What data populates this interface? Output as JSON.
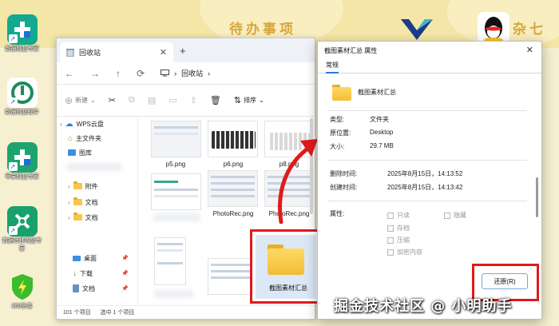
{
  "wallpaper": {
    "banner_text": "待办事项",
    "banner_text_right": "杂七杂",
    "colors": {
      "band": "#f3e6a6",
      "accent": "#d9a63c"
    }
  },
  "desktop": {
    "icons": [
      {
        "label": "数据恢复专家",
        "icon": "data-recovery-icon",
        "color": "#13a88f"
      },
      {
        "label": "数据恢复软件",
        "icon": "recovery-software-icon",
        "color": "#1e8a5a"
      },
      {
        "label": "苹果恢复专家",
        "icon": "apple-recovery-icon",
        "color": "#1ea36e"
      },
      {
        "label": "数据迁移恢复专家",
        "icon": "migration-recovery-icon",
        "color": "#19a06c"
      },
      {
        "label": "360杀毒",
        "icon": "shield-icon",
        "color": "#3cbb2c"
      }
    ],
    "top_right_apps": [
      "vs-logo-icon",
      "qq-icon"
    ]
  },
  "explorer": {
    "tab_title": "回收站",
    "breadcrumb": "回收站",
    "toolbar": {
      "new_label": "新建",
      "sort_label": "排序"
    },
    "sidebar": [
      {
        "label": "WPS云盘",
        "icon": "cloud-icon"
      },
      {
        "label": "主文件夹",
        "icon": "home-icon"
      },
      {
        "label": "图库",
        "icon": "gallery-icon"
      },
      {
        "label": "附件",
        "icon": "folder-icon"
      },
      {
        "label": "文档",
        "icon": "folder-icon"
      },
      {
        "label": "文档",
        "icon": "folder-icon"
      },
      {
        "label": "桌面",
        "icon": "desktop-icon"
      },
      {
        "label": "下载",
        "icon": "download-icon"
      },
      {
        "label": "文档",
        "icon": "docs-icon"
      }
    ],
    "files": [
      {
        "name": "p5.png"
      },
      {
        "name": "p6.png"
      },
      {
        "name": "p8.png"
      },
      {
        "name": "PhotoRec.png"
      },
      {
        "name": "PhotoRec.png"
      }
    ],
    "selected_folder": "截图素材汇总",
    "status": {
      "count": "101 个项目",
      "selected": "选中 1 个项目"
    }
  },
  "dialog": {
    "title": "截图素材汇总 属性",
    "tab": "常规",
    "folder_name": "截图素材汇总",
    "props": [
      {
        "label": "类型:",
        "value": "文件夹"
      },
      {
        "label": "原位置:",
        "value": "Desktop"
      },
      {
        "label": "大小:",
        "value": "29.7 MB"
      }
    ],
    "dates": [
      {
        "label": "删除时间:",
        "value": "2025年8月15日，14:13:52"
      },
      {
        "label": "创建时间:",
        "value": "2025年8月15日，14:13:42"
      }
    ],
    "attributes_label": "属性:",
    "attributes": [
      {
        "label": "只读"
      },
      {
        "label": "隐藏"
      },
      {
        "label": "存档"
      },
      {
        "label": "压缩"
      },
      {
        "label": "加密内容"
      }
    ],
    "restore_button": "还原(R)"
  },
  "watermark": "掘金技术社区 @ 小明助手",
  "highlight_color": "#e01a1a"
}
